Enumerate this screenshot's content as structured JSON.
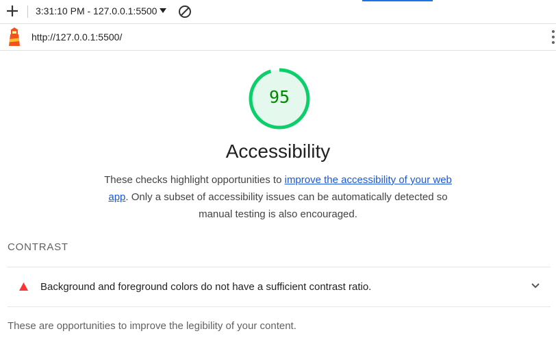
{
  "toolbar": {
    "new_report_icon": "plus-icon",
    "report_selector": "3:31:10 PM - 127.0.0.1:5500",
    "clear_icon": "block-icon"
  },
  "topbar": {
    "logo": "lighthouse-logo",
    "url": "http://127.0.0.1:5500/",
    "menu_icon": "kebab-menu-icon"
  },
  "category": {
    "score": "95",
    "score_fraction": 0.95,
    "title": "Accessibility",
    "description_before": "These checks highlight opportunities to ",
    "description_link": "improve the accessibility of your web app",
    "description_after": ". Only a subset of accessibility issues can be automatically detected so manual testing is also encouraged."
  },
  "group": {
    "title": "CONTRAST",
    "audit_title": "Background and foreground colors do not have a sufficient contrast ratio.",
    "description": "These are opportunities to improve the legibility of your content."
  },
  "colors": {
    "pass": "#0cce6b",
    "pass_text": "#008800",
    "pass_bg": "#e5f8ee",
    "fail": "#ff3333",
    "link": "#1a56db"
  }
}
